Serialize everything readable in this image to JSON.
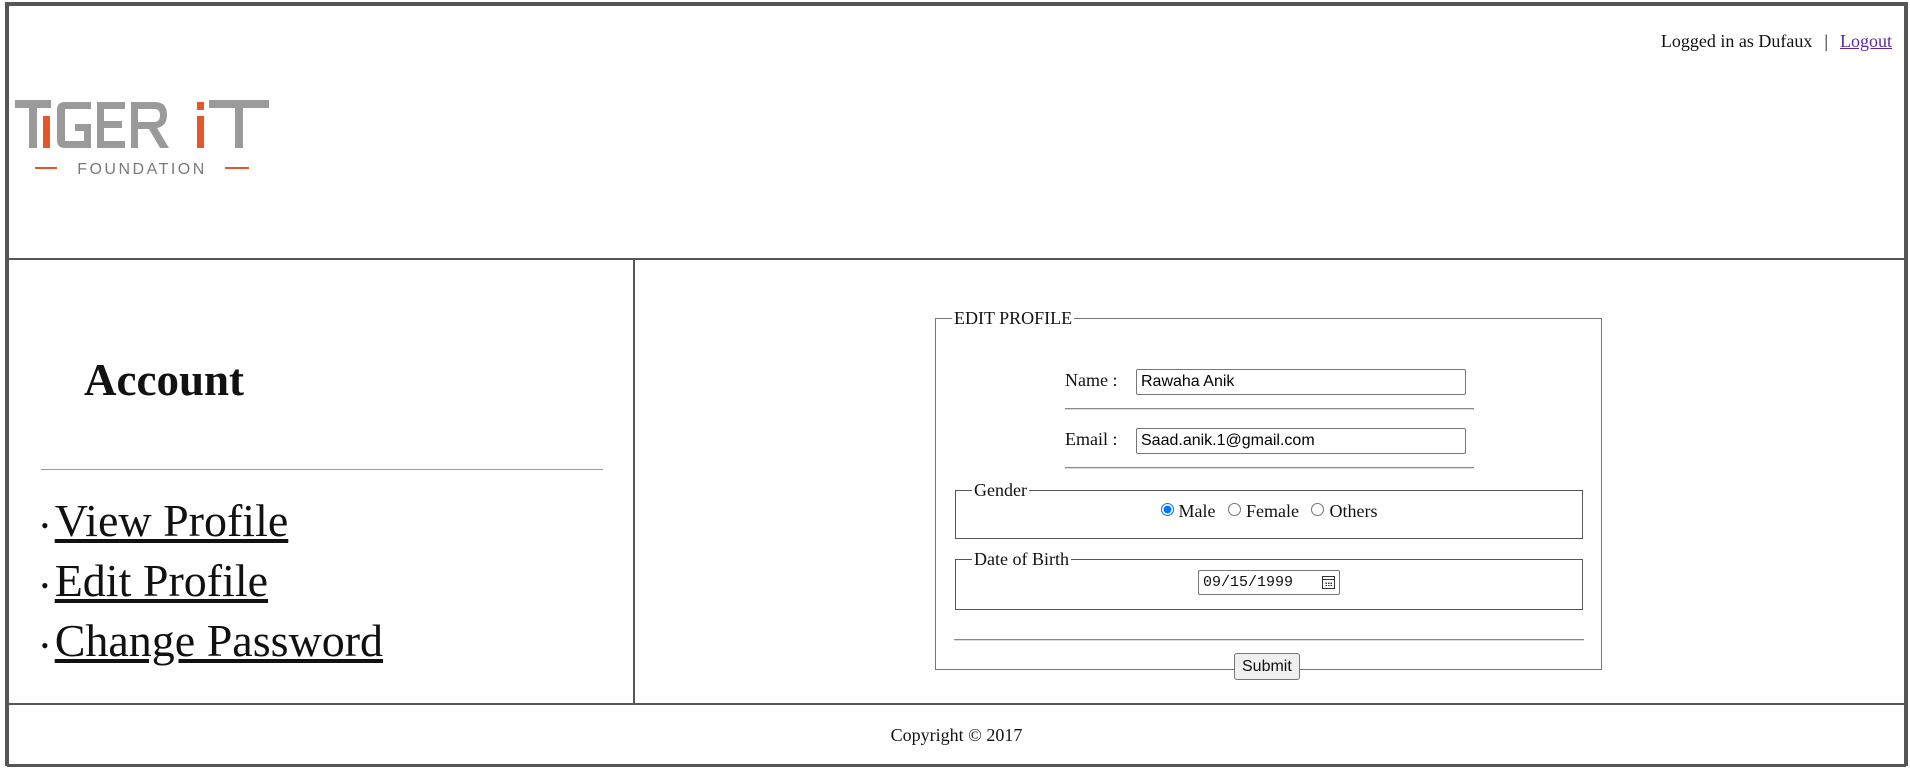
{
  "header": {
    "logged_in_text": "Logged in as Dufaux",
    "separator": "|",
    "logout_label": "Logout",
    "logo": {
      "brand_text": "TiGER iT",
      "sub_text": "FOUNDATION",
      "colors": {
        "gray": "#9a9a9a",
        "orange": "#e8552a"
      }
    }
  },
  "sidebar": {
    "title": "Account",
    "items": [
      {
        "label": "View Profile"
      },
      {
        "label": "Edit Profile"
      },
      {
        "label": "Change Password"
      }
    ]
  },
  "form": {
    "legend": "EDIT PROFILE",
    "name_label": "Name :",
    "name_value": "Rawaha Anik",
    "email_label": "Email :",
    "email_value": "Saad.anik.1@gmail.com",
    "gender": {
      "legend": "Gender",
      "options": [
        {
          "label": "Male",
          "checked": true
        },
        {
          "label": "Female",
          "checked": false
        },
        {
          "label": "Others",
          "checked": false
        }
      ]
    },
    "dob": {
      "legend": "Date of Birth",
      "value": "09/15/1999"
    },
    "submit_label": "Submit"
  },
  "footer": {
    "copyright": "Copyright © 2017"
  }
}
